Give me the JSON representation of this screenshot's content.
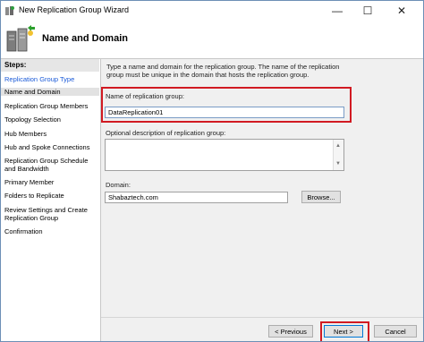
{
  "window": {
    "title": "New Replication Group Wizard"
  },
  "titlebar": {
    "min": "—",
    "max": "☐",
    "close": "✕"
  },
  "header": {
    "title": "Name and Domain"
  },
  "sidebar": {
    "steps_label": "Steps:",
    "items": [
      {
        "label": "Replication Group Type"
      },
      {
        "label": "Name and Domain"
      },
      {
        "label": "Replication Group Members"
      },
      {
        "label": "Topology Selection"
      },
      {
        "label": "Hub Members"
      },
      {
        "label": "Hub and Spoke Connections"
      },
      {
        "label": "Replication Group Schedule and Bandwidth"
      },
      {
        "label": "Primary Member"
      },
      {
        "label": "Folders to Replicate"
      },
      {
        "label": "Review Settings and Create Replication Group"
      },
      {
        "label": "Confirmation"
      }
    ]
  },
  "main": {
    "description": "Type a name and domain for the replication group. The name of the replication group must be unique in the domain that hosts the replication group.",
    "name_label": "Name of replication group:",
    "name_value": "DataReplication01",
    "optional_label": "Optional description of replication group:",
    "optional_value": "",
    "domain_label": "Domain:",
    "domain_value": "Shabaztech.com",
    "browse_label": "Browse..."
  },
  "footer": {
    "previous_label": "< Previous",
    "next_label": "Next >",
    "cancel_label": "Cancel"
  },
  "colors": {
    "highlight": "#d11a22",
    "active_link": "#1a5ad8"
  }
}
